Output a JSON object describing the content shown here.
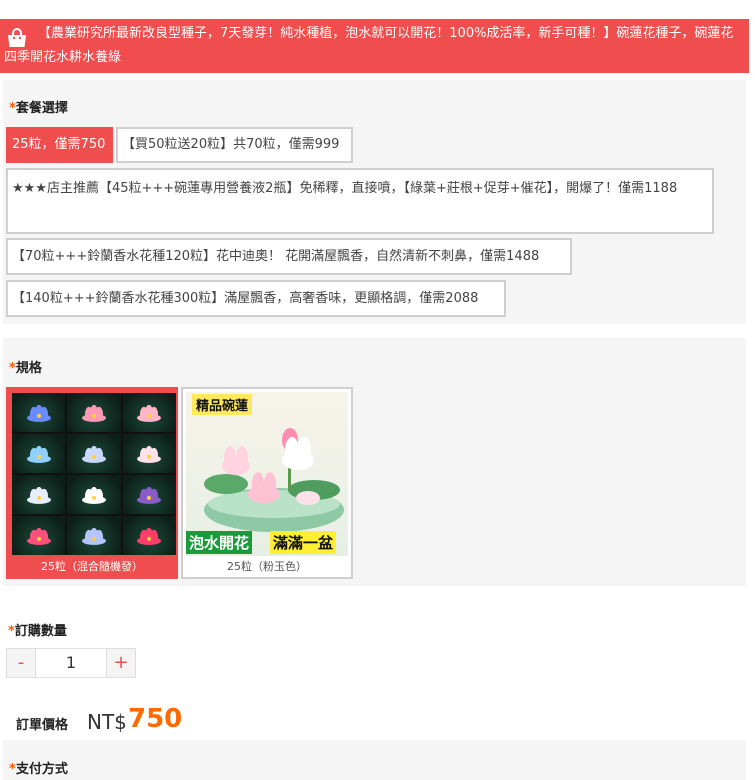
{
  "banner": {
    "text": "【農業研究所最新改良型種子，7天發芽！純水種植，泡水就可以開花！100%成活率，新手可種！】碗蓮花種子，碗蓮花四季開花水耕水養綠"
  },
  "package": {
    "required_mark": "*",
    "title": "套餐選擇",
    "options": [
      {
        "label": "25粒，僅需750",
        "selected": true
      },
      {
        "label": "【買50粒送20粒】共70粒，僅需999",
        "selected": false
      },
      {
        "label": "★★★店主推薦【45粒+++碗蓮專用營養液2瓶】免稀釋，直接噴，【綠葉+莊根+促芽+催花】，開爆了！僅需1188",
        "selected": false
      },
      {
        "label": "【70粒+++鈴蘭香水花種120粒】花中迪奧！ 花開滿屋飄香，自然清新不刺鼻，僅需1488",
        "selected": false
      },
      {
        "label": "【140粒+++鈴蘭香水花種300粒】滿屋飄香，高奢香味，更顯格調，僅需2088",
        "selected": false
      }
    ]
  },
  "spec": {
    "required_mark": "*",
    "title": "規格",
    "items": [
      {
        "caption": "25粒（混合隨機發）",
        "selected": true
      },
      {
        "caption": "25粒（粉玉色）",
        "selected": false,
        "tag_top": "精品碗蓮",
        "tag_left": "泡水開花",
        "tag_right": "滿滿一盆"
      }
    ],
    "lotus_colors": [
      "#6a8cff",
      "#ff9ab5",
      "#ffb6c8",
      "#8fd0ff",
      "#c9d8ff",
      "#ffe1ea",
      "#e8eeff",
      "#ffffff",
      "#8a5cc9",
      "#ff4f7b",
      "#b6c4ff",
      "#ff3f6a"
    ]
  },
  "quantity": {
    "required_mark": "*",
    "title": "訂購數量",
    "minus": "-",
    "value": "1",
    "plus": "+"
  },
  "price": {
    "label": "訂單價格",
    "currency": "NT$",
    "value": "750"
  },
  "payment": {
    "required_mark": "*",
    "title": "支付方式"
  }
}
